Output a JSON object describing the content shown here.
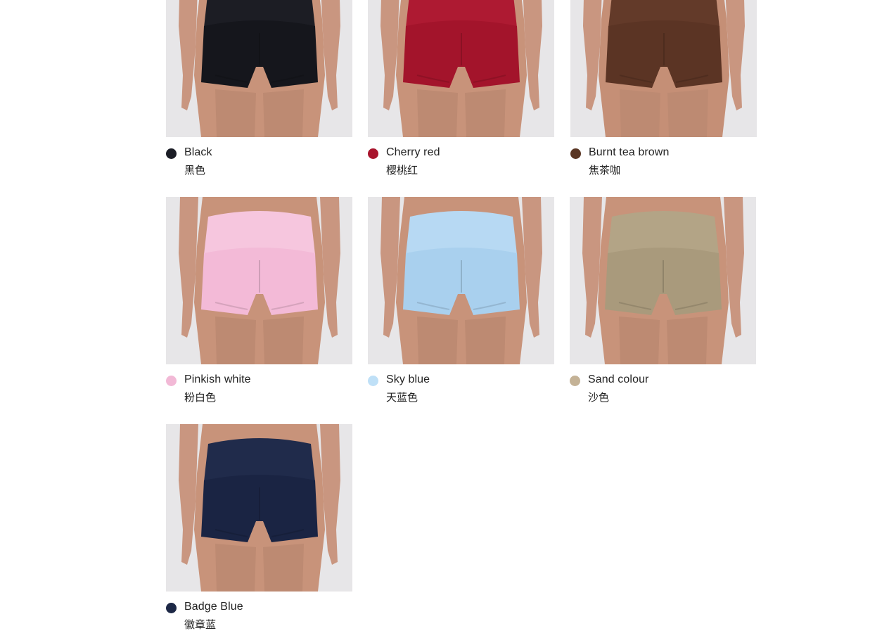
{
  "colors": [
    {
      "name_en": "Black",
      "name_cn": "黑色",
      "swatch": "#1b1d26",
      "fabric": "#15161c",
      "band": "#1c1d24",
      "skin": "#c8937a",
      "icon": "black-shorts-photo"
    },
    {
      "name_en": "Cherry red",
      "name_cn": "樱桃红",
      "swatch": "#a8142c",
      "fabric": "#a3142b",
      "band": "#ae1a32",
      "skin": "#c8937a",
      "icon": "cherry-red-shorts-photo"
    },
    {
      "name_en": "Burnt tea brown",
      "name_cn": "焦茶咖",
      "swatch": "#5a3624",
      "fabric": "#5b3424",
      "band": "#633a29",
      "skin": "#c58f76",
      "icon": "burnt-tea-brown-shorts-photo"
    },
    {
      "name_en": "Pinkish white",
      "name_cn": "粉白色",
      "swatch": "#f2b9d6",
      "fabric": "#f3bad7",
      "band": "#f6c6de",
      "skin": "#c8937a",
      "icon": "pinkish-white-shorts-photo"
    },
    {
      "name_en": "Sky blue",
      "name_cn": "天蓝色",
      "swatch": "#bfe0f7",
      "fabric": "#a9d0ee",
      "band": "#b7d9f3",
      "skin": "#c8937a",
      "icon": "sky-blue-shorts-photo"
    },
    {
      "name_en": "Sand colour",
      "name_cn": "沙色",
      "swatch": "#c4b296",
      "fabric": "#a99a7c",
      "band": "#b3a486",
      "skin": "#c8937a",
      "icon": "sand-colour-shorts-photo"
    },
    {
      "name_en": "Badge Blue",
      "name_cn": "徽章蓝",
      "swatch": "#1d2846",
      "fabric": "#1a2443",
      "band": "#202b4b",
      "skin": "#c8937a",
      "icon": "badge-blue-shorts-photo"
    }
  ]
}
